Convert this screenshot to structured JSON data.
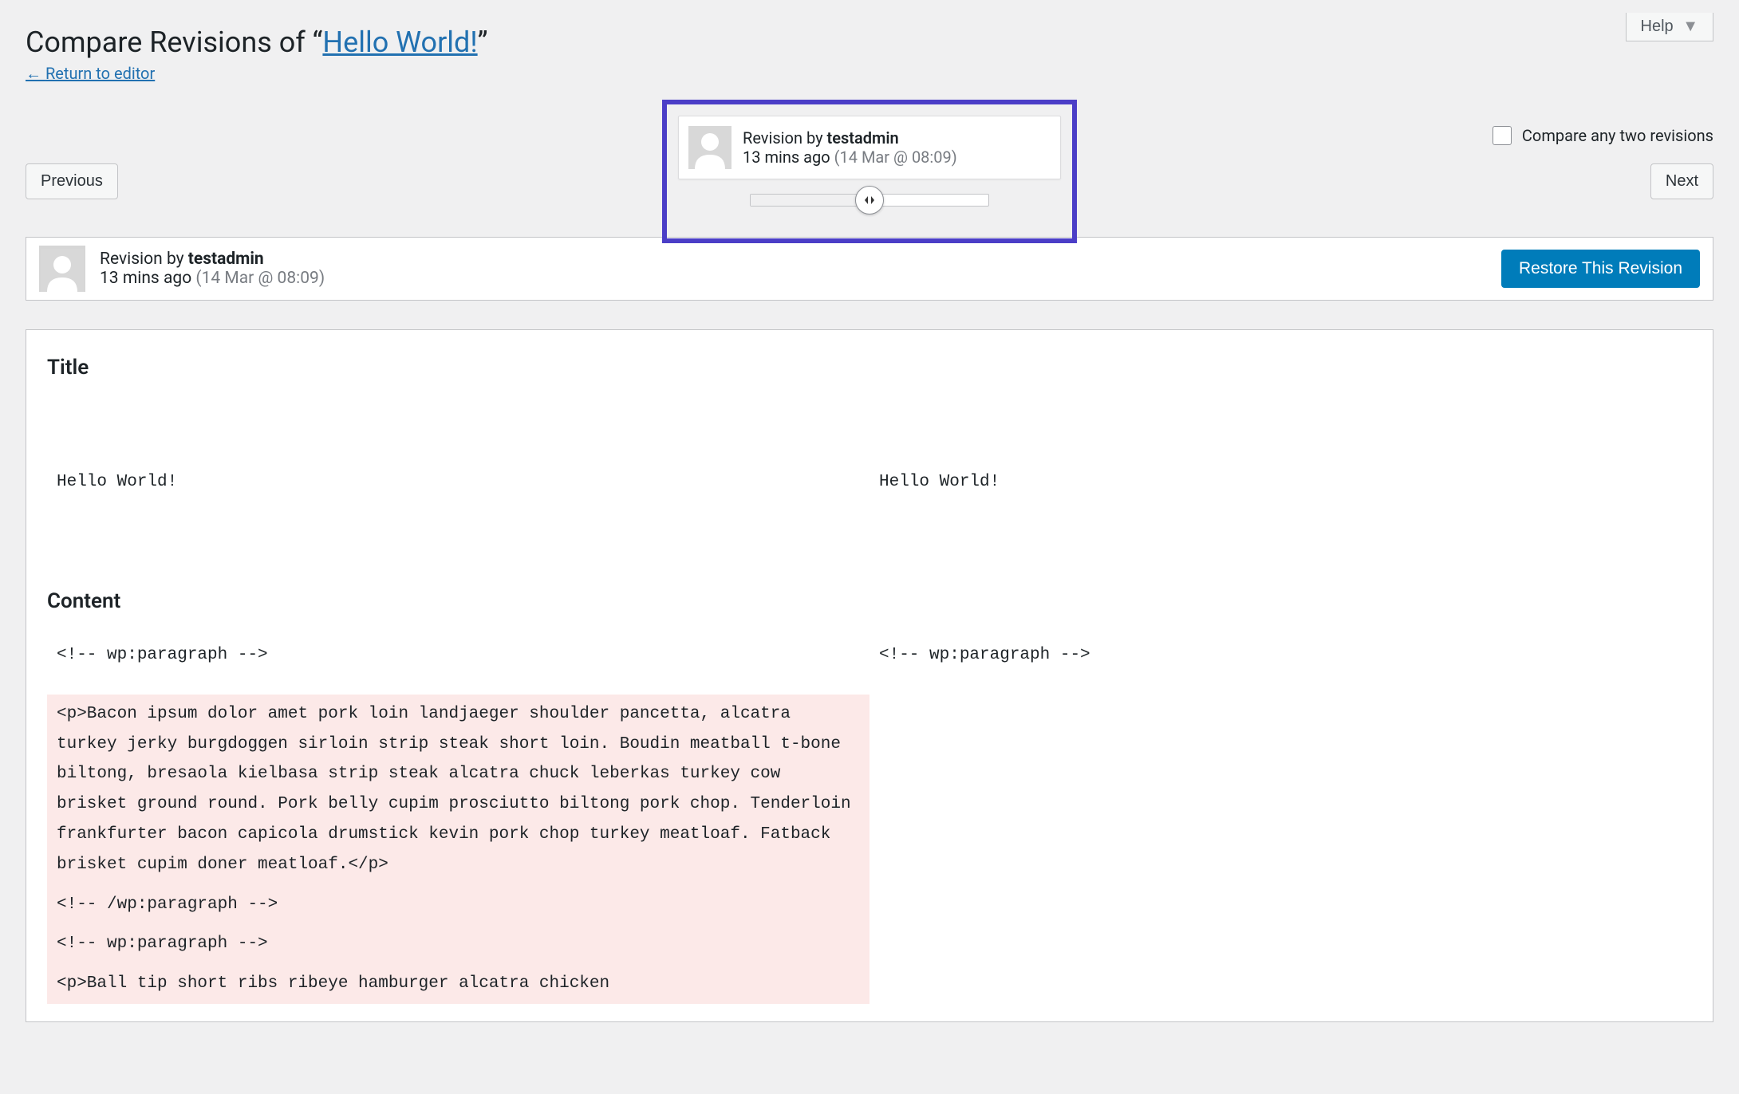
{
  "header": {
    "help_label": "Help",
    "title_prefix": "Compare Revisions of “",
    "post_title": "Hello World!",
    "title_suffix": "”",
    "return_arrow": "←",
    "return_label": "Return to editor"
  },
  "controls": {
    "previous_label": "Previous",
    "next_label": "Next",
    "compare_label": "Compare any two revisions"
  },
  "tooltip": {
    "by_prefix": "Revision by ",
    "author": "testadmin",
    "time_ago": "13 mins ago",
    "timestamp": "(14 Mar @ 08:09)"
  },
  "revision_bar": {
    "by_prefix": "Revision by ",
    "author": "testadmin",
    "time_ago": "13 mins ago",
    "timestamp": "(14 Mar @ 08:09)",
    "restore_label": "Restore This Revision"
  },
  "diff": {
    "title_section": "Title",
    "title_left": "Hello World!",
    "title_right": "Hello World!",
    "content_section": "Content",
    "left_lines": [
      {
        "text": "<!-- wp:paragraph -->",
        "removed": false
      },
      {
        "text": "<p>Bacon ipsum dolor amet pork loin landjaeger shoulder pancetta, alcatra turkey jerky burgdoggen sirloin strip steak short loin. Boudin meatball t-bone biltong, bresaola kielbasa strip steak alcatra chuck leberkas turkey cow brisket ground round. Pork belly cupim prosciutto biltong pork chop. Tenderloin frankfurter bacon capicola drumstick kevin pork chop turkey meatloaf. Fatback brisket cupim doner meatloaf.</p>",
        "removed": true
      },
      {
        "text": "<!-- /wp:paragraph -->",
        "removed": true
      },
      {
        "text": "<!-- wp:paragraph -->",
        "removed": true
      },
      {
        "text": "<p>Ball tip short ribs ribeye hamburger alcatra chicken",
        "removed": true
      }
    ],
    "right_lines": [
      {
        "text": "<!-- wp:paragraph -->",
        "removed": false
      }
    ]
  }
}
